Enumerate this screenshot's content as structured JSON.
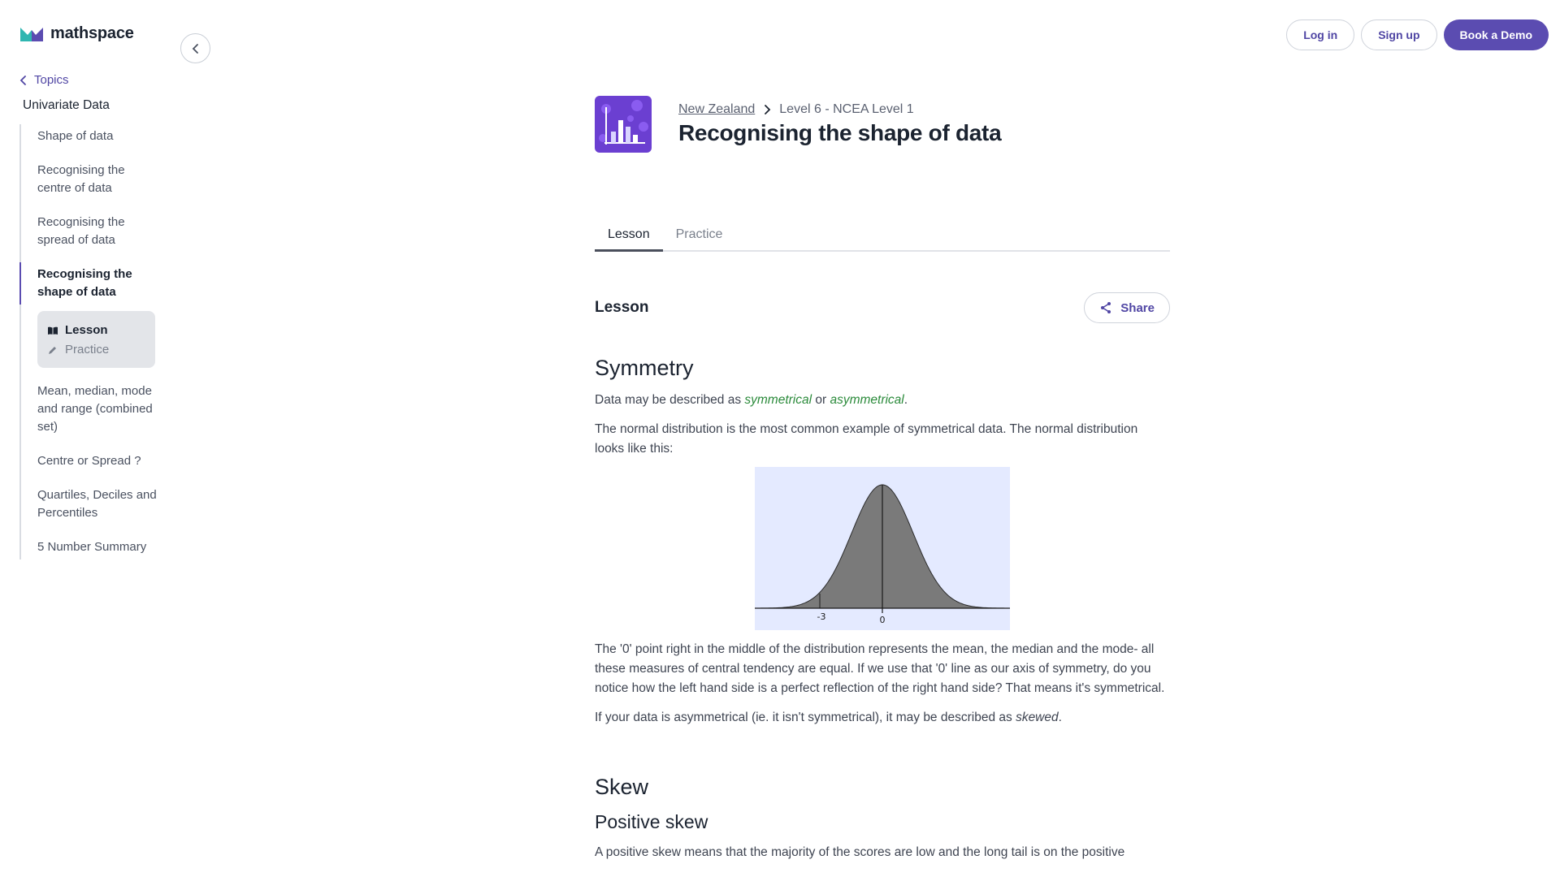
{
  "brand": {
    "name": "mathspace",
    "accent": "#5b4cb1"
  },
  "header": {
    "login_label": "Log in",
    "signup_label": "Sign up",
    "demo_label": "Book a Demo"
  },
  "sidebar": {
    "back_label": "Topics",
    "unit_title": "Univariate Data",
    "items": [
      {
        "label": "Shape of data"
      },
      {
        "label": "Recognising the centre of data"
      },
      {
        "label": "Recognising the spread of data"
      },
      {
        "label": "Recognising the shape of data"
      },
      {
        "label": "Mean, median, mode and range (combined set)"
      },
      {
        "label": "Centre or Spread ?"
      },
      {
        "label": "Quartiles, Deciles and Percentiles"
      },
      {
        "label": "5 Number Summary"
      }
    ],
    "sub_panel": {
      "lesson_label": "Lesson",
      "practice_label": "Practice"
    }
  },
  "main": {
    "breadcrumb": {
      "country": "New Zealand",
      "level": "Level 6 - NCEA Level 1"
    },
    "title": "Recognising the shape of data",
    "tabs": [
      {
        "label": "Lesson"
      },
      {
        "label": "Practice"
      }
    ],
    "section_label": "Lesson",
    "share_label": "Share",
    "content": {
      "h_symmetry": "Symmetry",
      "p1_a": "Data may be described as ",
      "p1_term1": "symmetrical",
      "p1_b": " or ",
      "p1_term2": "asymmetrical",
      "p1_c": ".",
      "p2": "The normal distribution is the most common example of symmetrical data. The normal distribution looks like this:",
      "figure": {
        "tick_neg": "-3",
        "tick_zero": "0"
      },
      "p3": "The '0' point right in the middle of the distribution represents the mean, the median and the mode- all these measures of central tendency are equal. If we use that '0' line as our axis of symmetry, do you notice how the left hand side is a perfect reflection of the right hand side? That means it's symmetrical.",
      "p4_a": "If your data is asymmetrical (ie. it isn't symmetrical), it may be described as ",
      "p4_term": "skewed",
      "p4_b": ".",
      "h_skew": "Skew",
      "h_positive": "Positive skew",
      "p5": "A positive skew means that the majority of the scores are low and the long tail is on the positive"
    }
  }
}
